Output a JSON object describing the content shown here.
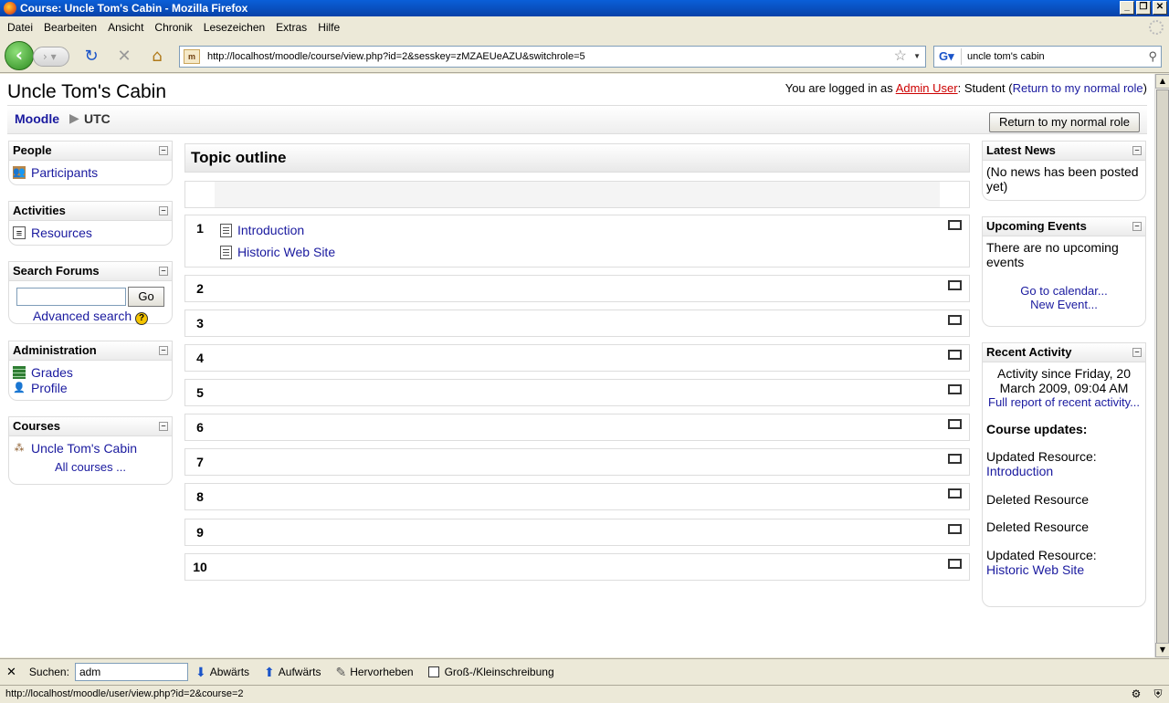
{
  "window": {
    "title": "Course: Uncle Tom's Cabin - Mozilla Firefox",
    "buttons": [
      "_",
      "❐",
      "✕"
    ]
  },
  "menu": [
    "Datei",
    "Bearbeiten",
    "Ansicht",
    "Chronik",
    "Lesezeichen",
    "Extras",
    "Hilfe"
  ],
  "nav": {
    "url": "http://localhost/moodle/course/view.php?id=2&sesskey=zMZAEUeAZU&switchrole=5",
    "search_value": "uncle tom's cabin"
  },
  "page": {
    "title": "Uncle Tom's Cabin",
    "login_prefix": "You are logged in as ",
    "login_user": "Admin User",
    "login_role": ": Student (",
    "login_return": "Return to my normal role",
    "login_suffix": ")",
    "breadcrumb": {
      "root": "Moodle",
      "sep": "▶",
      "current": "UTC"
    },
    "return_button": "Return to my normal role"
  },
  "left_blocks": {
    "people": {
      "title": "People",
      "items": [
        "Participants"
      ]
    },
    "activities": {
      "title": "Activities",
      "items": [
        "Resources"
      ]
    },
    "search_forums": {
      "title": "Search Forums",
      "go": "Go",
      "advanced": "Advanced search",
      "help": "?"
    },
    "administration": {
      "title": "Administration",
      "items": [
        "Grades",
        "Profile"
      ]
    },
    "courses": {
      "title": "Courses",
      "items": [
        "Uncle Tom's Cabin"
      ],
      "all": "All courses ..."
    }
  },
  "center": {
    "header": "Topic outline",
    "sections": [
      {
        "num": "1",
        "resources": [
          "Introduction",
          "Historic Web Site"
        ]
      },
      {
        "num": "2"
      },
      {
        "num": "3"
      },
      {
        "num": "4"
      },
      {
        "num": "5"
      },
      {
        "num": "6"
      },
      {
        "num": "7"
      },
      {
        "num": "8"
      },
      {
        "num": "9"
      },
      {
        "num": "10"
      }
    ]
  },
  "right_blocks": {
    "latest_news": {
      "title": "Latest News",
      "text": "(No news has been posted yet)"
    },
    "upcoming_events": {
      "title": "Upcoming Events",
      "text": "There are no upcoming events",
      "calendar": "Go to calendar...",
      "new_event": "New Event..."
    },
    "recent_activity": {
      "title": "Recent Activity",
      "since": "Activity since Friday, 20 March 2009, 09:04 AM",
      "full_report": "Full report of recent activity...",
      "updates_title": "Course updates:",
      "updates": [
        {
          "label": "Updated Resource:",
          "link": "Introduction"
        },
        {
          "label": "Deleted Resource"
        },
        {
          "label": "Deleted Resource"
        },
        {
          "label": "Updated Resource:",
          "link": "Historic Web Site"
        }
      ]
    }
  },
  "findbar": {
    "label": "Suchen:",
    "value": "adm",
    "down": "Abwärts",
    "up": "Aufwärts",
    "highlight": "Hervorheben",
    "case": "Groß-/Kleinschreibung"
  },
  "status": {
    "url": "http://localhost/moodle/user/view.php?id=2&course=2"
  }
}
